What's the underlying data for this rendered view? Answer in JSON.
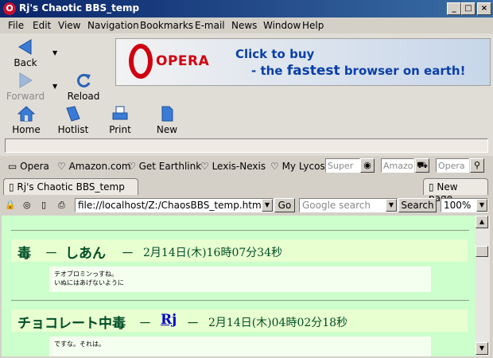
{
  "window": {
    "title": "Rj's Chaotic BBS_temp",
    "app_icon": "opera-o-icon"
  },
  "window_controls": {
    "minimize": "_",
    "maximize": "□",
    "close": "×"
  },
  "menu": [
    "File",
    "Edit",
    "View",
    "Navigation",
    "Bookmarks",
    "E-mail",
    "News",
    "Window",
    "Help"
  ],
  "toolbar": {
    "back": "Back",
    "forward": "Forward",
    "reload": "Reload",
    "home": "Home",
    "hotlist": "Hotlist",
    "print": "Print",
    "new": "New"
  },
  "banner": {
    "logo": "OPERA",
    "line1": "Click to buy",
    "line2_prefix": "- the ",
    "line2_emph": "fastest",
    "line2_suffix": " browser on earth!"
  },
  "personal_bar": {
    "items": [
      "Opera",
      "Amazon.com",
      "Get Earthlink",
      "Lexis-Nexis",
      "My Lycos"
    ],
    "search_inputs": [
      "Super",
      "Amazo",
      "Opera"
    ]
  },
  "tabs": {
    "active": "Rj's Chaotic BBS_temp",
    "new_page": "New page"
  },
  "address": {
    "url": "file://localhost/Z:/ChaosBBS_temp.html",
    "go": "Go",
    "search_placeholder": "Google search",
    "search_button": "Search",
    "zoom": "100%"
  },
  "posts": [
    {
      "name": "毒",
      "sep1": "－",
      "author": "しあん",
      "sep2": "－",
      "date": "2月14日(木)16時07分34秒",
      "body_line1": "テオブロミンっすね。",
      "body_line2": "いぬにはあげないように"
    },
    {
      "name": "チョコレート中毒",
      "sep1": "－",
      "author": "Rj",
      "sep2": "－",
      "date": "2月14日(木)04時02分18秒",
      "body_line1": "ですな。それは。",
      "body_line2": ""
    }
  ],
  "colors": {
    "content_bg": "#ccffcc",
    "post_head_bg": "#e8ffd0",
    "heading_text": "#004d26",
    "link": "#0000cc",
    "titlebar_start": "#0a246a",
    "titlebar_end": "#3a6ea5"
  }
}
